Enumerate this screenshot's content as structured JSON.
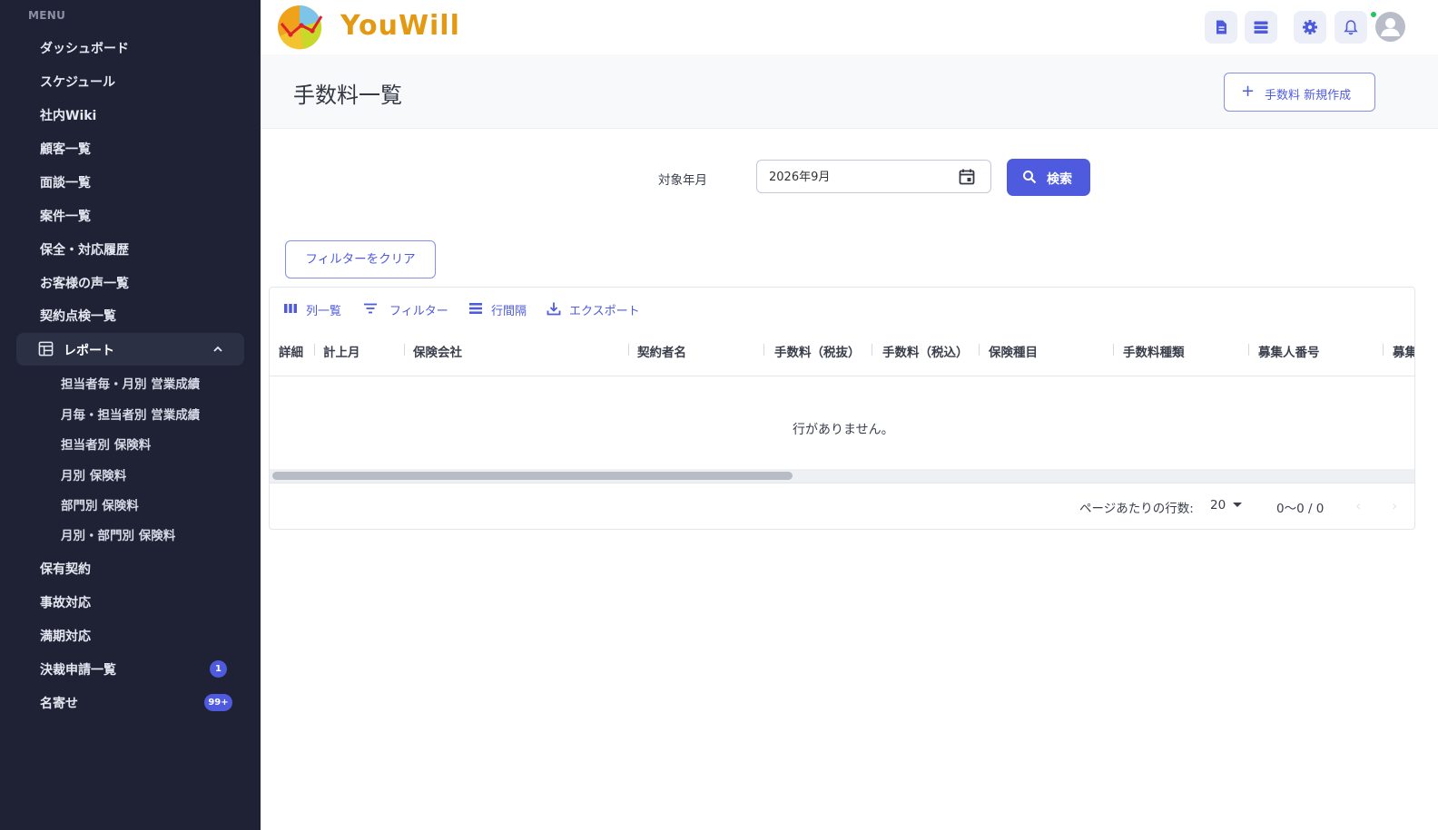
{
  "sidebar": {
    "heading": "MENU",
    "items": [
      {
        "label": "ダッシュボード"
      },
      {
        "label": "スケジュール"
      },
      {
        "label": "社内Wiki"
      },
      {
        "label": "顧客一覧"
      },
      {
        "label": "面談一覧"
      },
      {
        "label": "案件一覧"
      },
      {
        "label": "保全・対応履歴"
      },
      {
        "label": "お客様の声一覧"
      },
      {
        "label": "契約点検一覧"
      }
    ],
    "report_group": {
      "label": "レポート",
      "expanded": true,
      "subitems": [
        {
          "label": "担当者毎・月別 営業成績"
        },
        {
          "label": "月毎・担当者別 営業成績"
        },
        {
          "label": "担当者別 保険料"
        },
        {
          "label": "月別 保険料"
        },
        {
          "label": "部門別 保険料"
        },
        {
          "label": "月別・部門別 保険料"
        }
      ]
    },
    "items_after": [
      {
        "label": "保有契約",
        "badge": ""
      },
      {
        "label": "事故対応",
        "badge": ""
      },
      {
        "label": "満期対応",
        "badge": ""
      },
      {
        "label": "決裁申請一覧",
        "badge": "1"
      },
      {
        "label": "名寄せ",
        "badge": "99+"
      }
    ]
  },
  "header": {
    "logo_text": "YouWill",
    "icons": [
      "document-icon",
      "list-icon",
      "gear-icon",
      "bell-icon"
    ],
    "notification_status_color": "#22c55e"
  },
  "page": {
    "title": "手数料一覧",
    "new_button_label": "手数料 新規作成"
  },
  "search": {
    "label": "対象年月",
    "value": "2026年9月",
    "button_label": "検索"
  },
  "filter_clear_label": "フィルターをクリア",
  "grid": {
    "toolbar": {
      "columns_label": "列一覧",
      "filter_label": "フィルター",
      "density_label": "行間隔",
      "export_label": "エクスポート"
    },
    "columns": [
      "詳細",
      "計上月",
      "保険会社",
      "契約者名",
      "手数料（税抜）",
      "手数料（税込）",
      "保険種目",
      "手数料種類",
      "募集人番号",
      "募集"
    ],
    "empty_message": "行がありません。",
    "rows": [],
    "footer": {
      "rows_per_page_label": "ページあたりの行数:",
      "rows_per_page": "20",
      "range_label": "0〜0 / 0"
    }
  },
  "colors": {
    "sidebar_bg": "#1f2235",
    "accent": "#4f5bdf",
    "badge": "#4f5bdf"
  }
}
